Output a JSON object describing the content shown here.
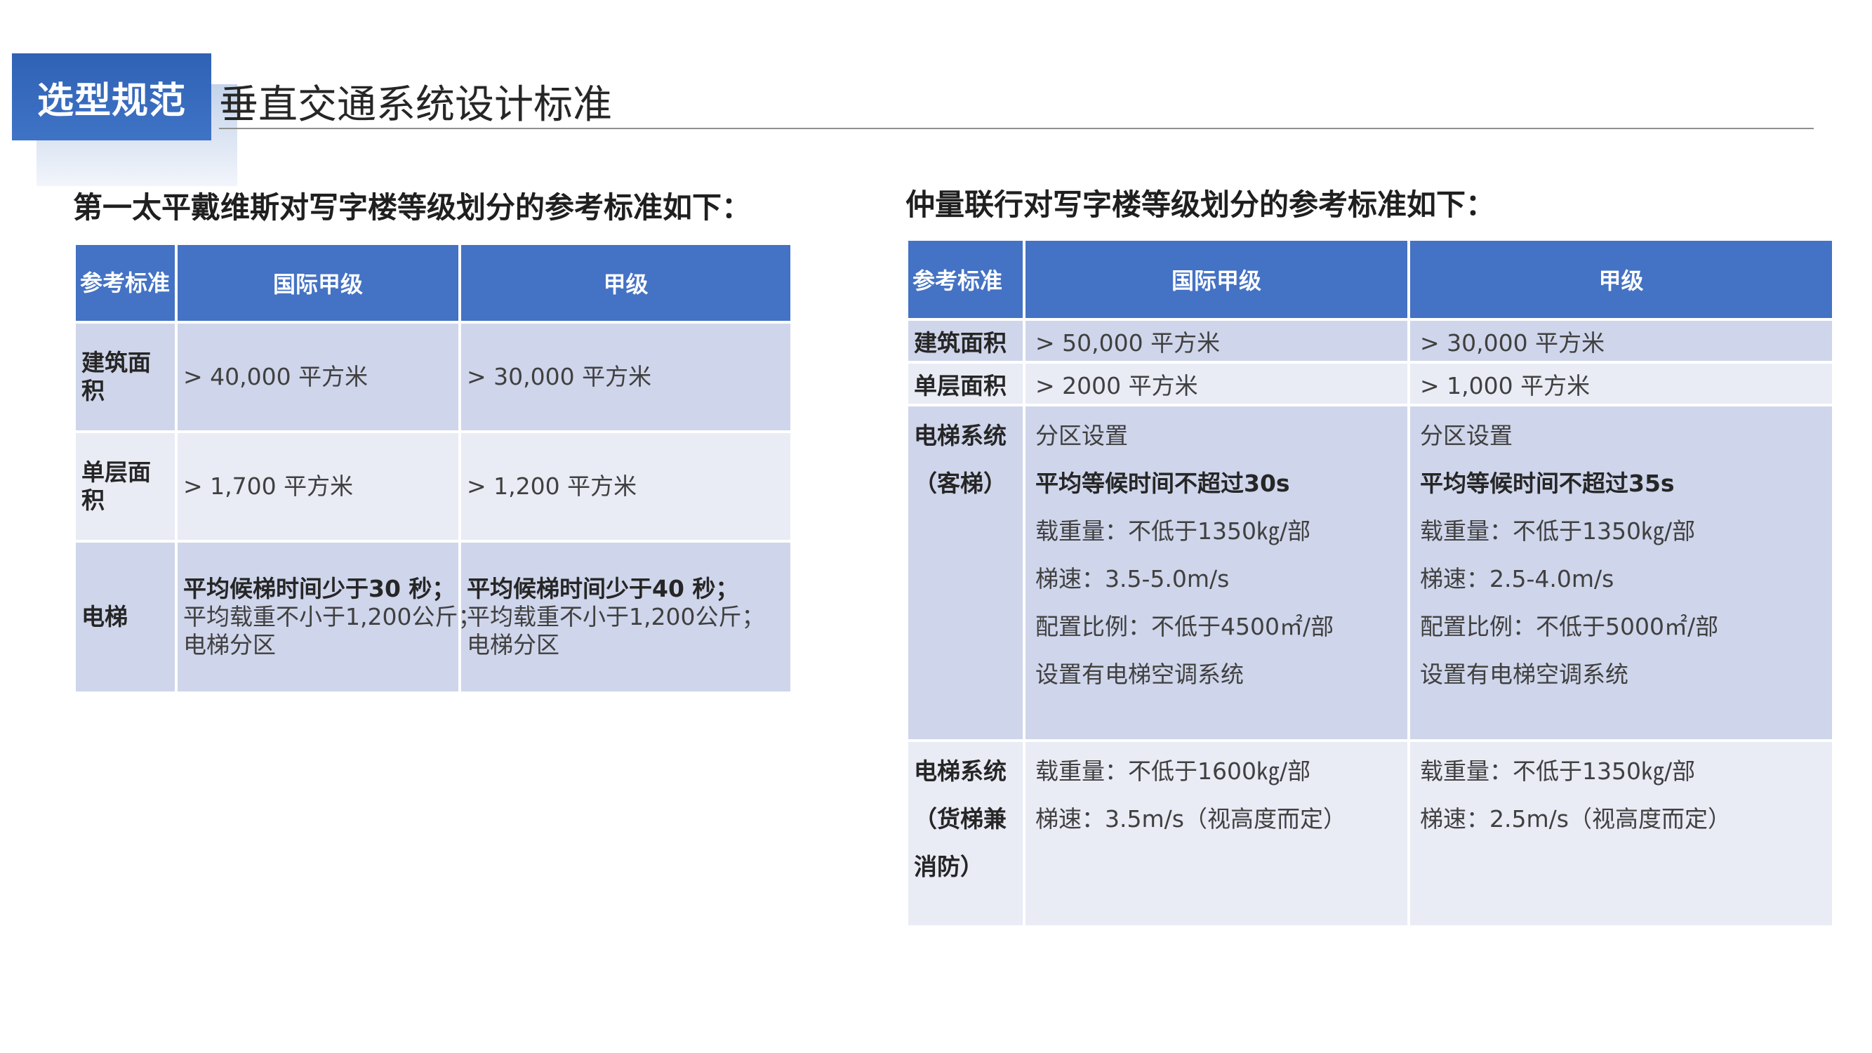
{
  "header": {
    "badge": "选型规范",
    "title": "垂直交通系统设计标准"
  },
  "left": {
    "heading": "第一太平戴维斯对写字楼等级划分的参考标准如下：",
    "columns": [
      "参考标准",
      "国际甲级",
      "甲级"
    ],
    "rows": [
      {
        "label": "建筑面积",
        "intl": [
          "> 40,000 平方米"
        ],
        "a": [
          "> 30,000 平方米"
        ]
      },
      {
        "label": "单层面积",
        "intl": [
          "> 1,700 平方米"
        ],
        "a": [
          "> 1,200 平方米"
        ]
      },
      {
        "label": "电梯",
        "intl": [
          "平均候梯时间少于30 秒；",
          "平均载重不小于1,200公斤；",
          "电梯分区"
        ],
        "a": [
          "平均候梯时间少于40 秒；",
          "平均载重不小于1,200公斤；",
          "电梯分区"
        ]
      }
    ]
  },
  "right": {
    "heading": "仲量联行对写字楼等级划分的参考标准如下：",
    "columns": [
      "参考标准",
      "国际甲级",
      "甲级"
    ],
    "rows": [
      {
        "label": [
          "建筑面积"
        ],
        "intl": [
          "> 50,000 平方米"
        ],
        "a": [
          "> 30,000 平方米"
        ]
      },
      {
        "label": [
          "单层面积"
        ],
        "intl": [
          "> 2000 平方米"
        ],
        "a": [
          "> 1,000 平方米"
        ]
      },
      {
        "label": [
          "电梯系统",
          "（客梯）"
        ],
        "intl": [
          "分区设置",
          "平均等候时间不超过30s",
          "载重量：不低于1350㎏/部",
          "梯速：3.5-5.0m/s",
          "配置比例：不低于4500㎡/部",
          "设置有电梯空调系统"
        ],
        "a": [
          "分区设置",
          "平均等候时间不超过35s",
          "载重量：不低于1350㎏/部",
          "梯速：2.5-4.0m/s",
          "配置比例：不低于5000㎡/部",
          "设置有电梯空调系统"
        ]
      },
      {
        "label": [
          "电梯系统",
          "（货梯兼",
          "消防）"
        ],
        "intl": [
          "载重量：不低于1600㎏/部",
          "梯速：3.5m/s（视高度而定）"
        ],
        "a": [
          "载重量：不低于1350㎏/部",
          "梯速：2.5m/s（视高度而定）"
        ]
      }
    ]
  }
}
